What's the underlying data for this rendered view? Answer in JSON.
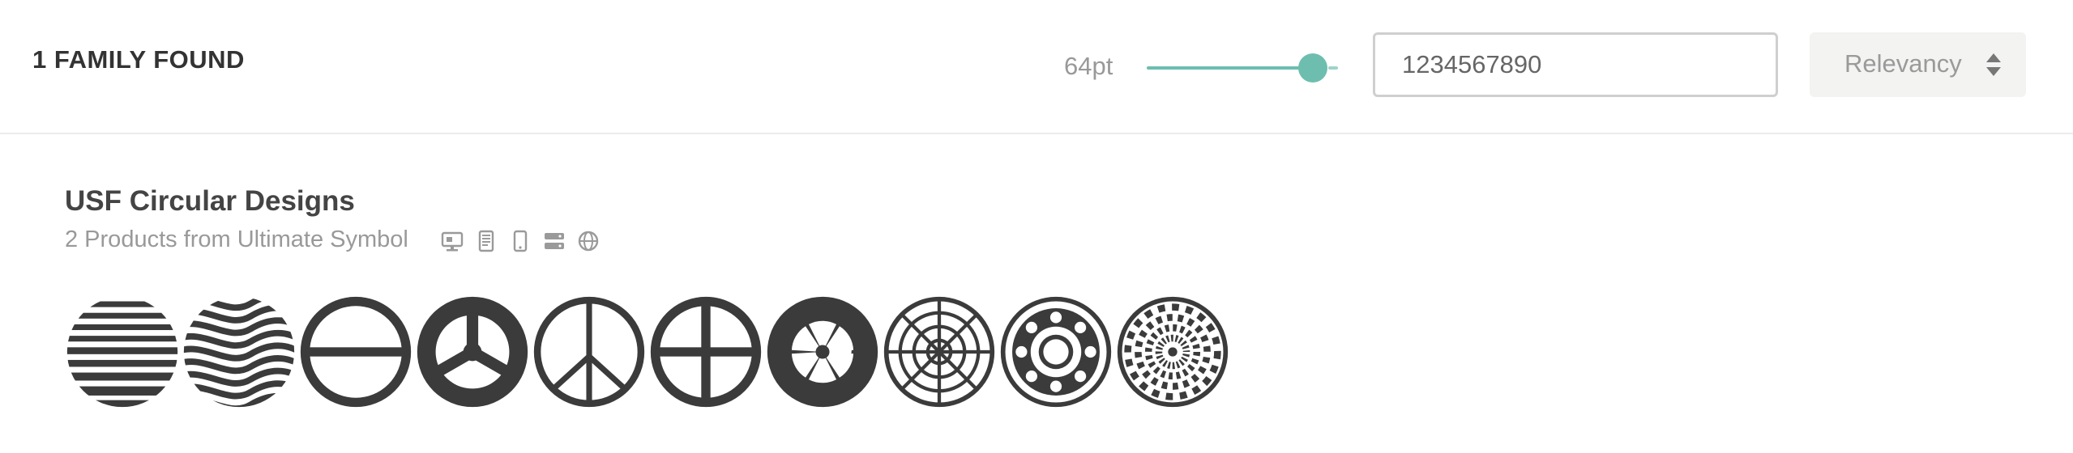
{
  "results": {
    "count_label": "1 FAMILY FOUND"
  },
  "controls": {
    "size_label": "64pt",
    "size_value_fraction": 0.87,
    "preview_text": "1234567890",
    "sort_label": "Relevancy",
    "accent_color": "#6dbeaf"
  },
  "family": {
    "name": "USF Circular Designs",
    "subtitle": "2 Products from Ultimate Symbol",
    "platform_icons": [
      "desktop-icon",
      "ebook-icon",
      "mobile-app-icon",
      "server-icon",
      "web-icon"
    ],
    "glyph_icons": [
      "horizontal-stripes-circle-icon",
      "wavy-stripes-circle-icon",
      "theta-circle-icon",
      "peace-solid-circle-icon",
      "peace-outline-circle-icon",
      "cross-circle-icon",
      "six-spoke-wheel-icon",
      "spiderweb-circle-icon",
      "bearing-circle-icon",
      "dartboard-icon"
    ]
  }
}
